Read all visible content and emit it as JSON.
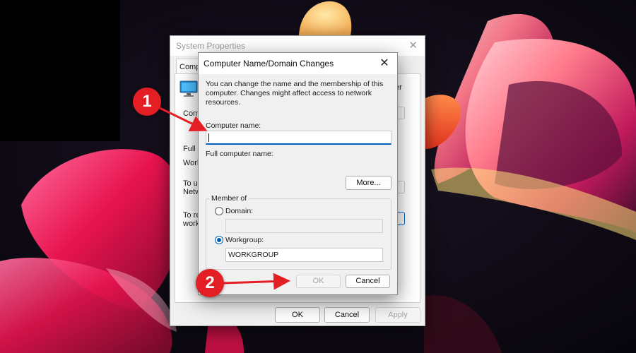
{
  "system_properties": {
    "title": "System Properties",
    "tab_fragment": "Compu",
    "fragments": {
      "right_er": "er",
      "comp": "Comp",
      "full_c": "Full c",
      "work": "Work",
      "to_us": "To us",
      "netw": "Netw",
      "to_re": "To re",
      "work2": "work"
    },
    "buttons": {
      "ok": "OK",
      "cancel": "Cancel",
      "apply": "Apply"
    }
  },
  "dialog": {
    "title": "Computer Name/Domain Changes",
    "description": "You can change the name and the membership of this computer. Changes might affect access to network resources.",
    "computer_name_label": "Computer name:",
    "computer_name_value": "",
    "full_name_label": "Full computer name:",
    "more_button": "More...",
    "member_of_legend": "Member of",
    "domain_label": "Domain:",
    "domain_value": "",
    "workgroup_label": "Workgroup:",
    "workgroup_value": "WORKGROUP",
    "selected_membership": "workgroup",
    "ok_button": "OK",
    "cancel_button": "Cancel"
  },
  "annotations": {
    "step1": "1",
    "step2": "2",
    "color": "#e31e24"
  }
}
